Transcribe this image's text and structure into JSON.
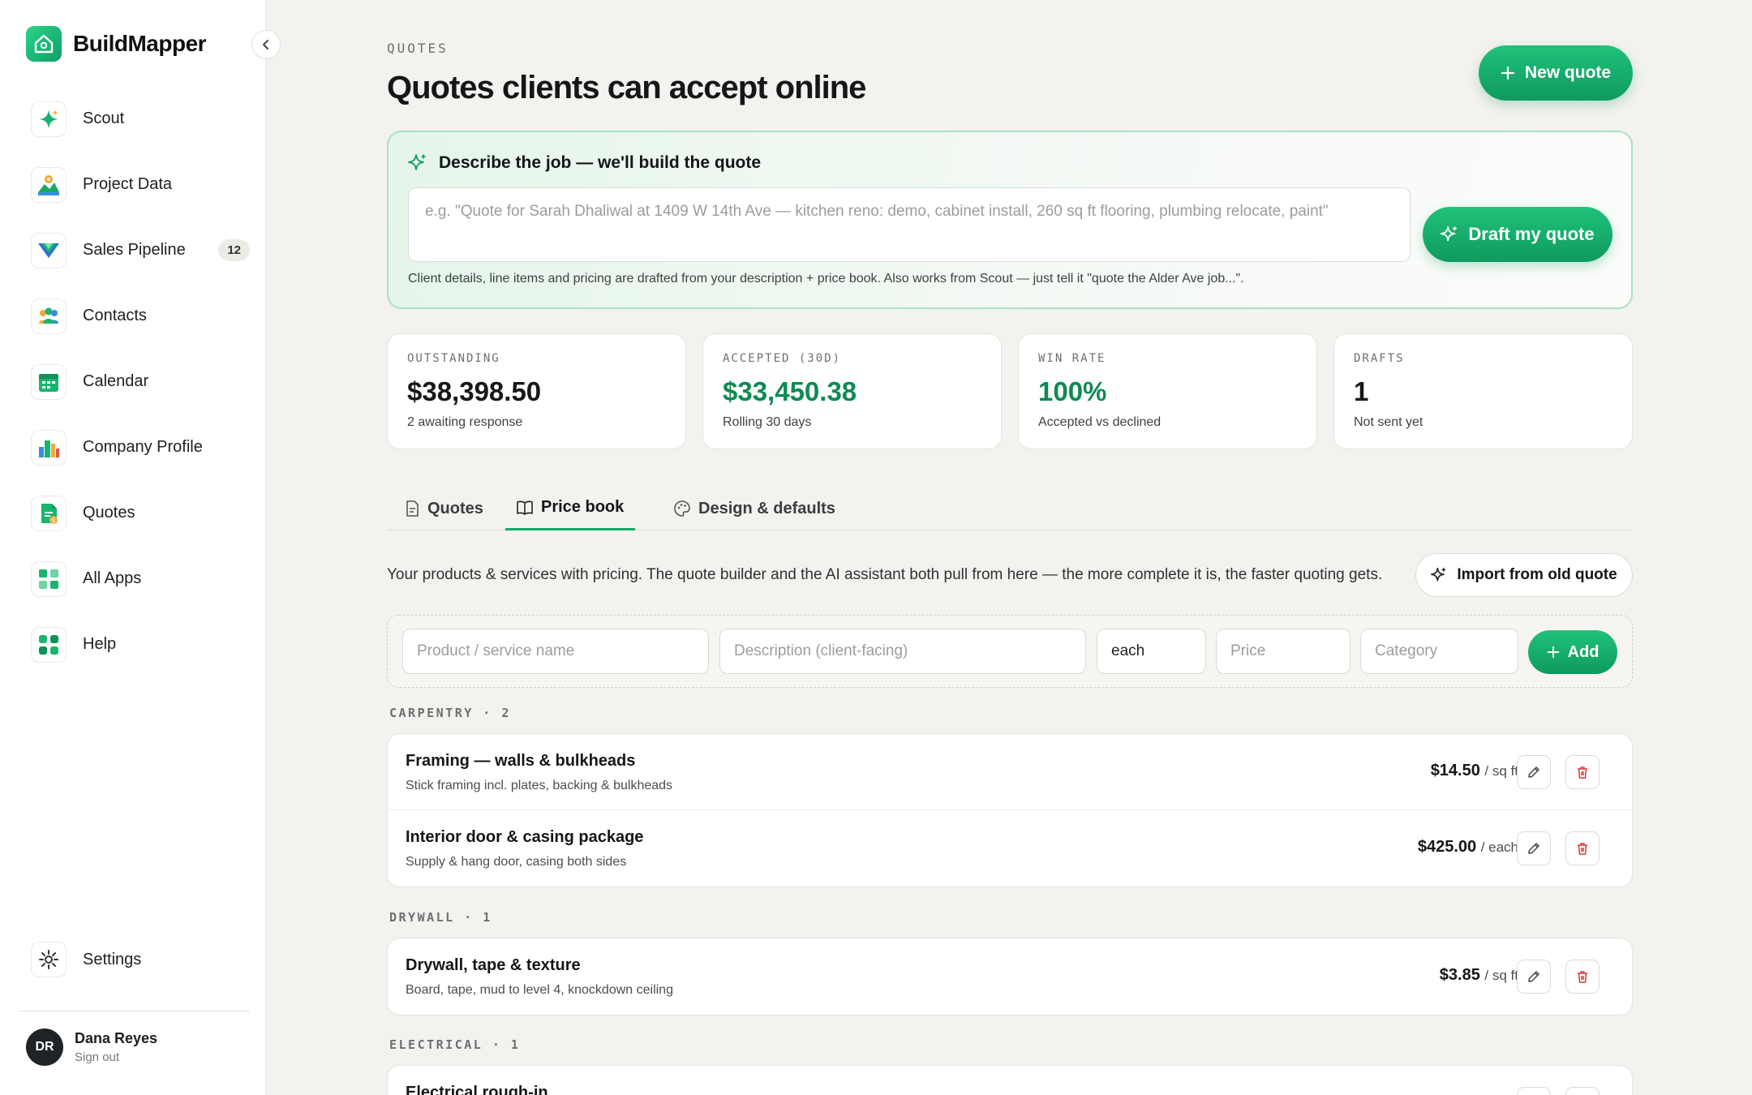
{
  "app": {
    "name": "BuildMapper"
  },
  "sidebar": {
    "items": [
      {
        "label": "Scout"
      },
      {
        "label": "Project Data"
      },
      {
        "label": "Sales Pipeline",
        "badge": "12"
      },
      {
        "label": "Contacts"
      },
      {
        "label": "Calendar"
      },
      {
        "label": "Company Profile"
      },
      {
        "label": "Quotes"
      },
      {
        "label": "All Apps"
      },
      {
        "label": "Help"
      }
    ],
    "settings_label": "Settings",
    "user": {
      "initials": "DR",
      "name": "Dana Reyes",
      "action": "Sign out"
    }
  },
  "header": {
    "eyebrow": "QUOTES",
    "title": "Quotes clients can accept online",
    "new_quote_label": "New quote"
  },
  "ai": {
    "heading": "Describe the job — we'll build the quote",
    "placeholder": "e.g. \"Quote for Sarah Dhaliwal at 1409 W 14th Ave — kitchen reno: demo, cabinet install, 260 sq ft flooring, plumbing relocate, paint\"",
    "button_label": "Draft my quote",
    "note": "Client details, line items and pricing are drafted from your description + price book. Also works from Scout — just tell it \"quote the Alder Ave job...\"."
  },
  "stats": [
    {
      "label": "OUTSTANDING",
      "value": "$38,398.50",
      "sub": "2 awaiting response"
    },
    {
      "label": "ACCEPTED (30D)",
      "value": "$33,450.38",
      "sub": "Rolling 30 days"
    },
    {
      "label": "WIN RATE",
      "value": "100%",
      "sub": "Accepted vs declined"
    },
    {
      "label": "DRAFTS",
      "value": "1",
      "sub": "Not sent yet"
    }
  ],
  "tabs": [
    {
      "label": "Quotes"
    },
    {
      "label": "Price book"
    },
    {
      "label": "Design & defaults"
    }
  ],
  "pricebook": {
    "description": "Your products & services with pricing. The quote builder and the AI assistant both pull from here — the more complete it is, the faster quoting gets.",
    "import_label": "Import from old quote",
    "form": {
      "name_placeholder": "Product / service name",
      "desc_placeholder": "Description (client-facing)",
      "unit_value": "each",
      "price_placeholder": "Price",
      "category_placeholder": "Category",
      "add_label": "Add"
    },
    "categories": [
      {
        "label": "CARPENTRY · 2",
        "items": [
          {
            "name": "Framing — walls & bulkheads",
            "desc": "Stick framing incl. plates, backing & bulkheads",
            "price": "$14.50",
            "unit": "/ sq ft"
          },
          {
            "name": "Interior door & casing package",
            "desc": "Supply & hang door, casing both sides",
            "price": "$425.00",
            "unit": "/ each"
          }
        ]
      },
      {
        "label": "DRYWALL · 1",
        "items": [
          {
            "name": "Drywall, tape & texture",
            "desc": "Board, tape, mud to level 4, knockdown ceiling",
            "price": "$3.85",
            "unit": "/ sq ft"
          }
        ]
      },
      {
        "label": "ELECTRICAL · 1",
        "items": [
          {
            "name": "Electrical rough-in",
            "desc": "",
            "price": "",
            "unit": ""
          }
        ]
      }
    ]
  }
}
